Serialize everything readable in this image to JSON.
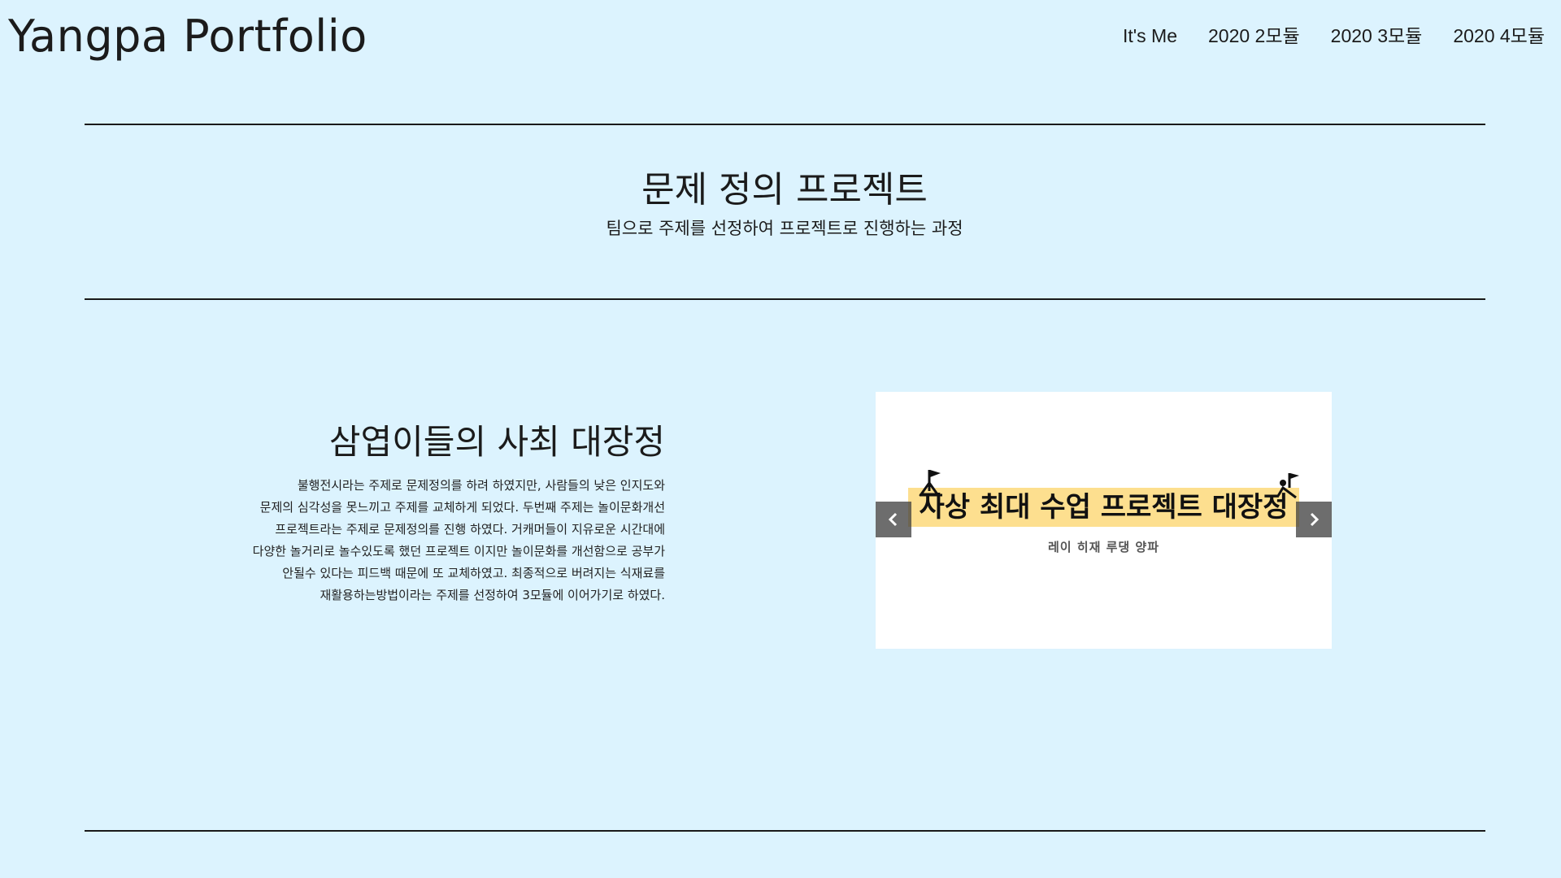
{
  "header": {
    "brand": "Yangpa Portfolio",
    "nav": [
      "It's Me",
      "2020 2모듈",
      "2020 3모듈",
      "2020 4모듈"
    ]
  },
  "section": {
    "title": "문제 정의 프로젝트",
    "subtitle": "팀으로 주제를 선정하여 프로젝트로 진행하는 과정"
  },
  "project": {
    "title": "삼엽이들의 사최 대장정",
    "description_lines": [
      "불행전시라는 주제로 문제정의를 하려 하였지만, 사람들의 낮은 인지도와",
      "문제의 심각성을 못느끼고 주제를 교체하게 되었다. 두번째 주제는 놀이문화개선",
      "프로젝트라는 주제로 문제정의를 진행 하였다. 거캐머들이 지유로운 시간대에",
      "다양한 놀거리로 놀수있도록 했던 프로젝트 이지만 놀이문화를 개선함으로 공부가",
      "안될수 있다는 피드백 때문에 또 교체하였고. 최종적으로 버려지는 식재료를",
      "재활용하는방법이라는 주제를 선정하여 3모듈에 이어가기로 하였다."
    ]
  },
  "carousel": {
    "slide_title": "사상 최대 수업 프로젝트 대장정",
    "slide_credits": "레이 히재 루댕 양파",
    "band_color": "#fddf8f",
    "prev_icon": "chevron-left-icon",
    "next_icon": "chevron-right-icon"
  },
  "colors": {
    "background": "#dcf3fe",
    "rule": "#1a1a1a"
  }
}
